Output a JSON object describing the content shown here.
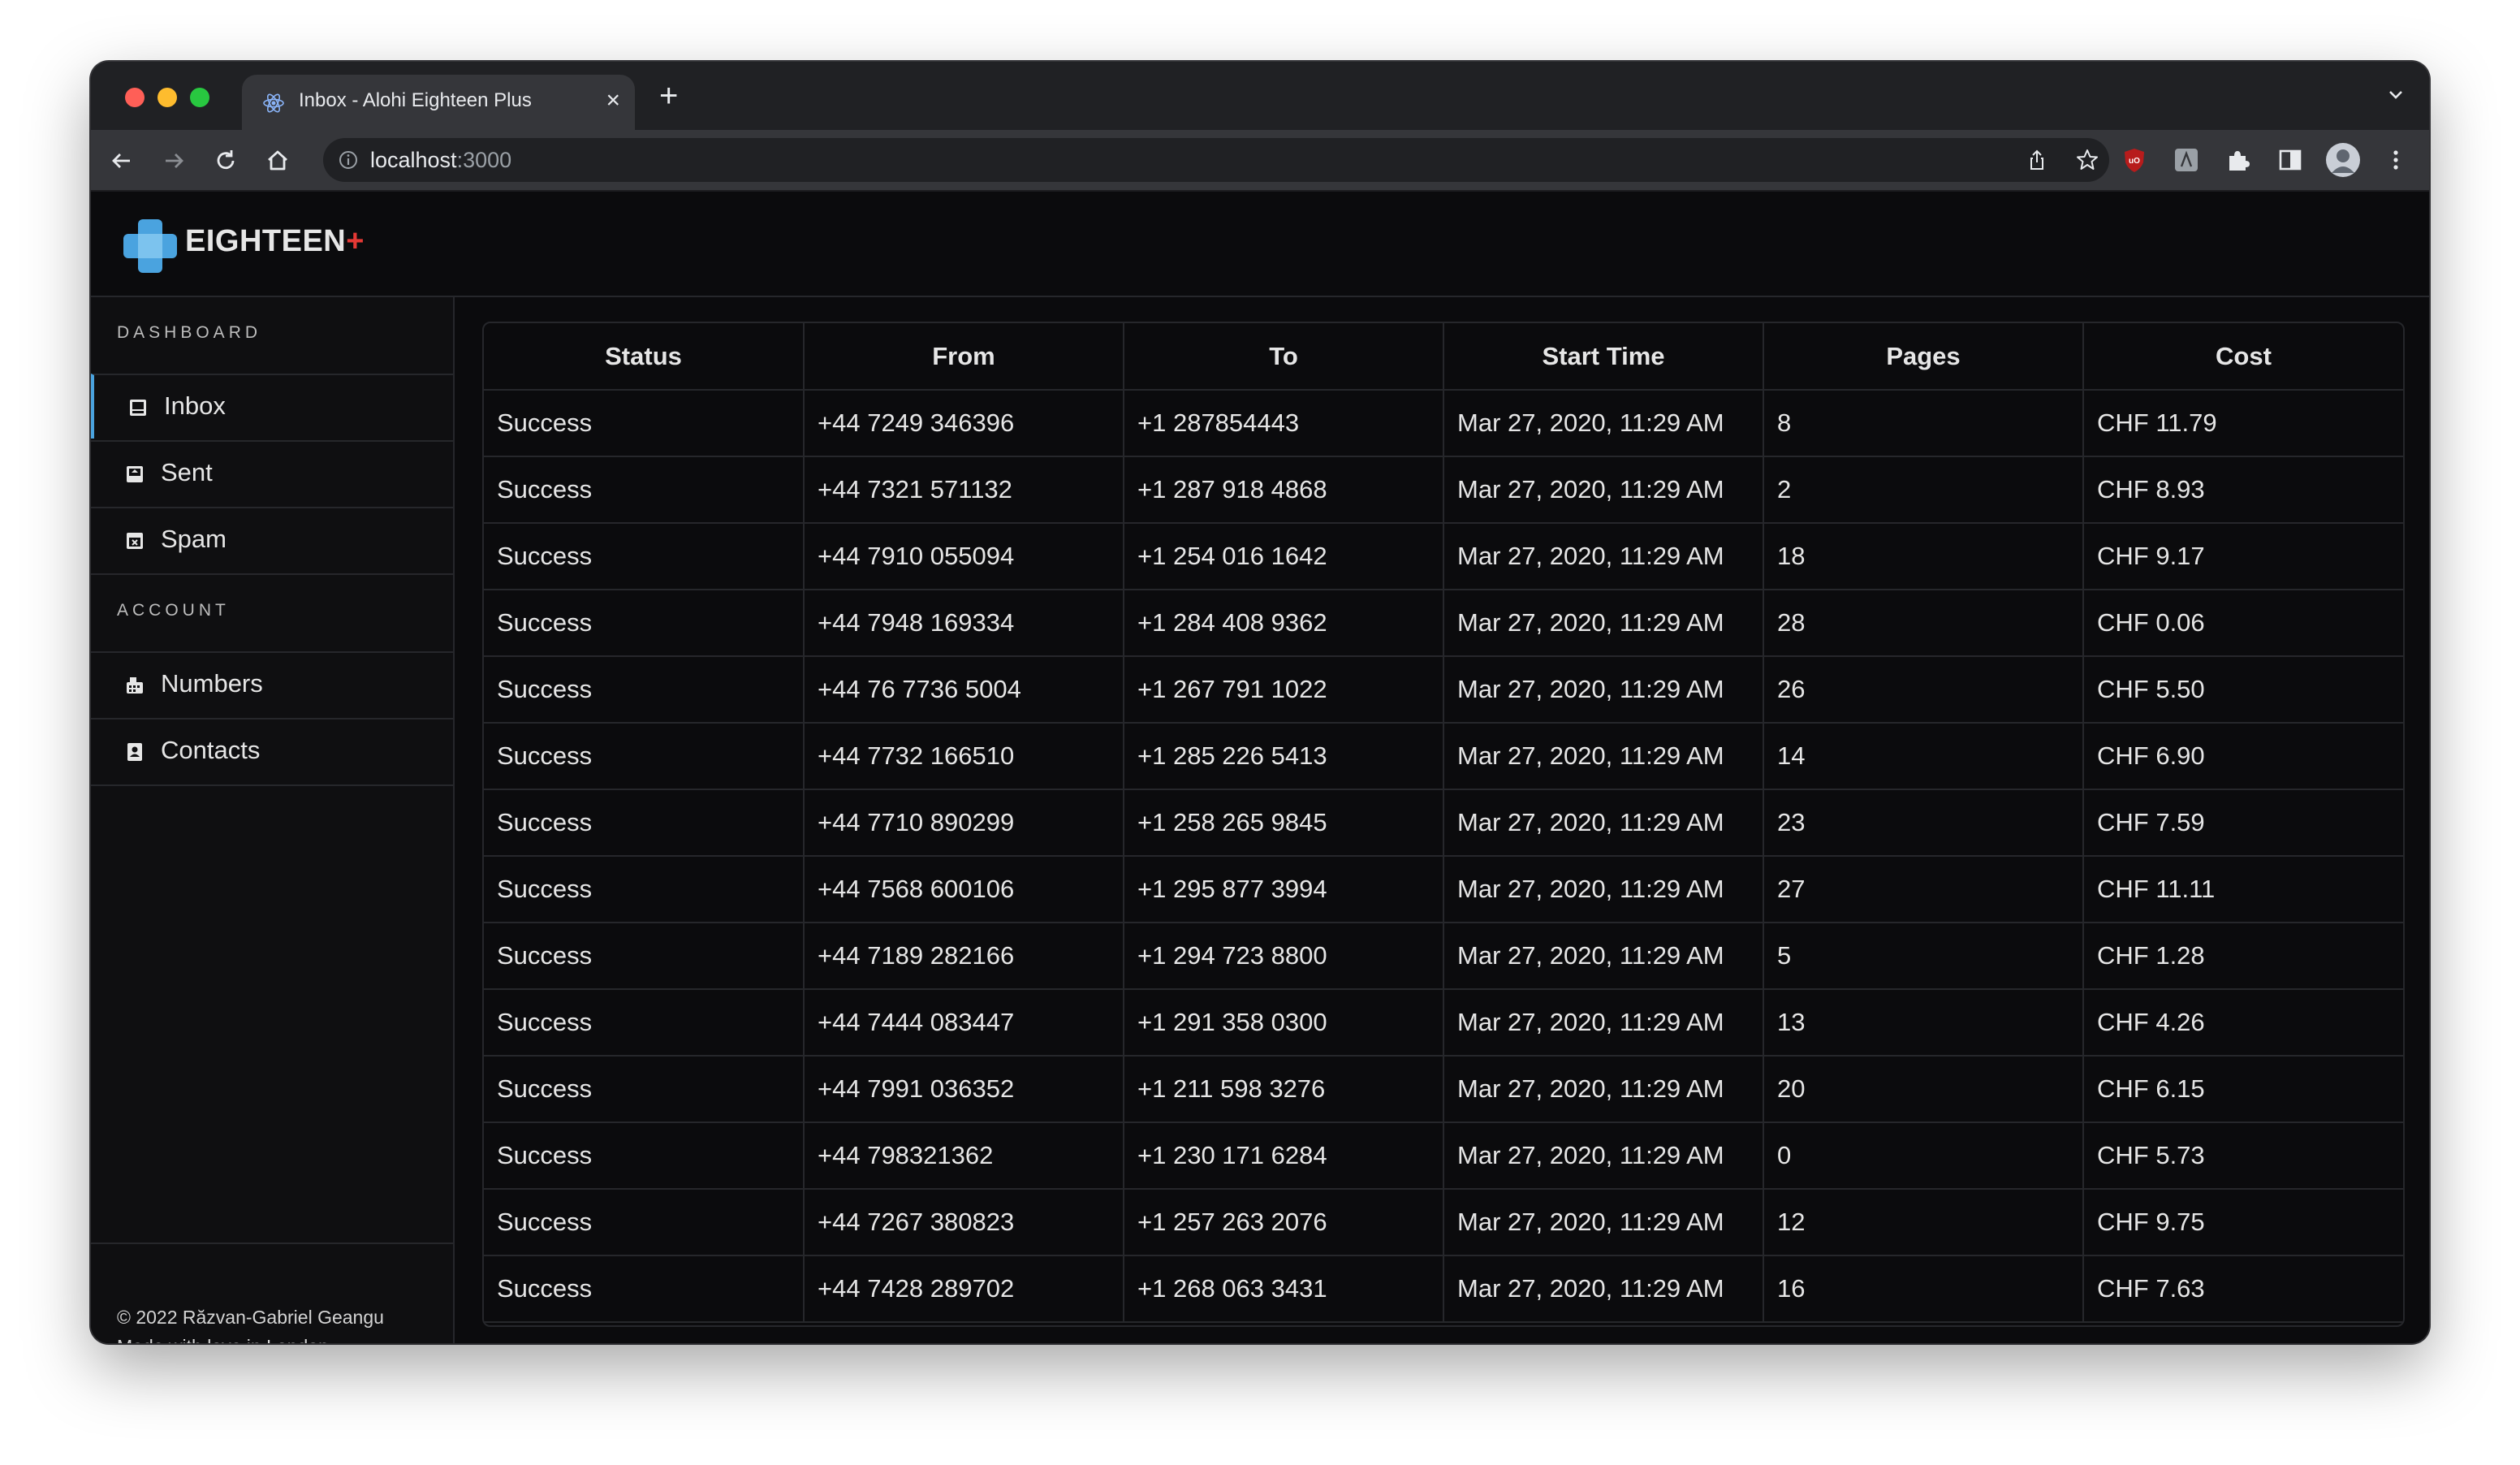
{
  "browser": {
    "tab_title": "Inbox - Alohi Eighteen Plus",
    "tab_close": "×",
    "new_tab": "+",
    "url_host": "localhost",
    "url_port": ":3000"
  },
  "app": {
    "brand_name": "EIGHTEEN",
    "brand_plus": "+",
    "brand_color": "#4aa3df",
    "accent_red": "#e53935"
  },
  "sidebar": {
    "dashboard_label": "DASHBOARD",
    "account_label": "ACCOUNT",
    "items": [
      {
        "label": "Inbox",
        "icon": "inbox-icon",
        "active": true
      },
      {
        "label": "Sent",
        "icon": "sent-icon",
        "active": false
      },
      {
        "label": "Spam",
        "icon": "spam-icon",
        "active": false
      },
      {
        "label": "Numbers",
        "icon": "numbers-icon",
        "active": false
      },
      {
        "label": "Contacts",
        "icon": "contacts-icon",
        "active": false
      }
    ],
    "footer": {
      "line1": "© 2022 Răzvan-Gabriel Geangu",
      "line2": "Made with love in London"
    }
  },
  "table": {
    "headers": [
      "Status",
      "From",
      "To",
      "Start Time",
      "Pages",
      "Cost"
    ],
    "rows": [
      [
        "Success",
        "+44 7249 346396",
        "+1 287854443",
        "Mar 27, 2020, 11:29 AM",
        "8",
        "CHF 11.79"
      ],
      [
        "Success",
        "+44 7321 571132",
        "+1 287 918 4868",
        "Mar 27, 2020, 11:29 AM",
        "2",
        "CHF 8.93"
      ],
      [
        "Success",
        "+44 7910 055094",
        "+1 254 016 1642",
        "Mar 27, 2020, 11:29 AM",
        "18",
        "CHF 9.17"
      ],
      [
        "Success",
        "+44 7948 169334",
        "+1 284 408 9362",
        "Mar 27, 2020, 11:29 AM",
        "28",
        "CHF 0.06"
      ],
      [
        "Success",
        "+44 76 7736 5004",
        "+1 267 791 1022",
        "Mar 27, 2020, 11:29 AM",
        "26",
        "CHF 5.50"
      ],
      [
        "Success",
        "+44 7732 166510",
        "+1 285 226 5413",
        "Mar 27, 2020, 11:29 AM",
        "14",
        "CHF 6.90"
      ],
      [
        "Success",
        "+44 7710 890299",
        "+1 258 265 9845",
        "Mar 27, 2020, 11:29 AM",
        "23",
        "CHF 7.59"
      ],
      [
        "Success",
        "+44 7568 600106",
        "+1 295 877 3994",
        "Mar 27, 2020, 11:29 AM",
        "27",
        "CHF 11.11"
      ],
      [
        "Success",
        "+44 7189 282166",
        "+1 294 723 8800",
        "Mar 27, 2020, 11:29 AM",
        "5",
        "CHF 1.28"
      ],
      [
        "Success",
        "+44 7444 083447",
        "+1 291 358 0300",
        "Mar 27, 2020, 11:29 AM",
        "13",
        "CHF 4.26"
      ],
      [
        "Success",
        "+44 7991 036352",
        "+1 211 598 3276",
        "Mar 27, 2020, 11:29 AM",
        "20",
        "CHF 6.15"
      ],
      [
        "Success",
        "+44 798321362",
        "+1 230 171 6284",
        "Mar 27, 2020, 11:29 AM",
        "0",
        "CHF 5.73"
      ],
      [
        "Success",
        "+44 7267 380823",
        "+1 257 263 2076",
        "Mar 27, 2020, 11:29 AM",
        "12",
        "CHF 9.75"
      ],
      [
        "Success",
        "+44 7428 289702",
        "+1 268 063 3431",
        "Mar 27, 2020, 11:29 AM",
        "16",
        "CHF 7.63"
      ]
    ]
  }
}
